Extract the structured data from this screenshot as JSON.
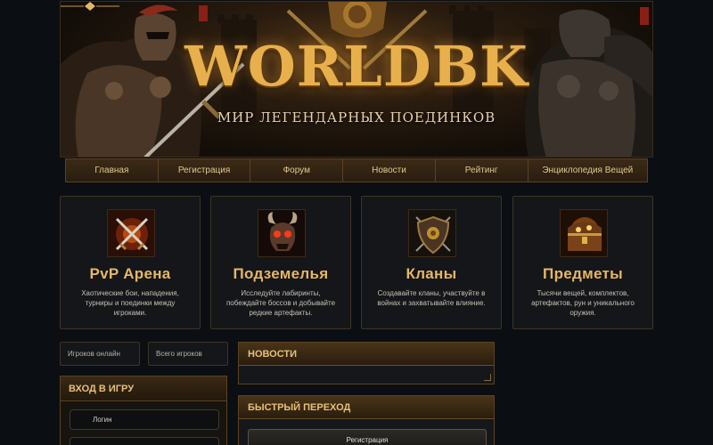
{
  "banner": {
    "logo": "WORLDBK",
    "tagline": "МИР ЛЕГЕНДАРНЫХ ПОЕДИНКОВ"
  },
  "nav": {
    "items": [
      {
        "label": "Главная"
      },
      {
        "label": "Регистрация"
      },
      {
        "label": "Форум"
      },
      {
        "label": "Новости"
      },
      {
        "label": "Рейтинг"
      },
      {
        "label": "Энциклопедия Вещей"
      }
    ]
  },
  "features": [
    {
      "title": "PvP Арена",
      "desc": "Хаотические бои, нападения, турниры и поединки между игроками.",
      "icon": "crossed-swords-icon"
    },
    {
      "title": "Подземелья",
      "desc": "Исследуйте лабиринты, побеждайте боссов и добывайте редкие артефакты.",
      "icon": "demon-skull-icon"
    },
    {
      "title": "Кланы",
      "desc": "Создавайте кланы, участвуйте в войнах и захватывайте влияние.",
      "icon": "shield-icon"
    },
    {
      "title": "Предметы",
      "desc": "Тысячи вещей, комплектов, артефактов, рун и уникального оружия.",
      "icon": "treasure-chest-icon"
    }
  ],
  "stats": {
    "online": "Игроков онлайн",
    "total": "Всего игроков"
  },
  "login": {
    "title": "ВХОД В ИГРУ",
    "login_field": "Логин"
  },
  "news": {
    "title": "НОВОСТИ"
  },
  "quick": {
    "title": "БЫСТРЫЙ ПЕРЕХОД",
    "button": "Регистрация"
  },
  "colors": {
    "accent": "#e6b765",
    "background": "#0b0e12",
    "panel": "#15171a",
    "border": "#5b4223"
  }
}
